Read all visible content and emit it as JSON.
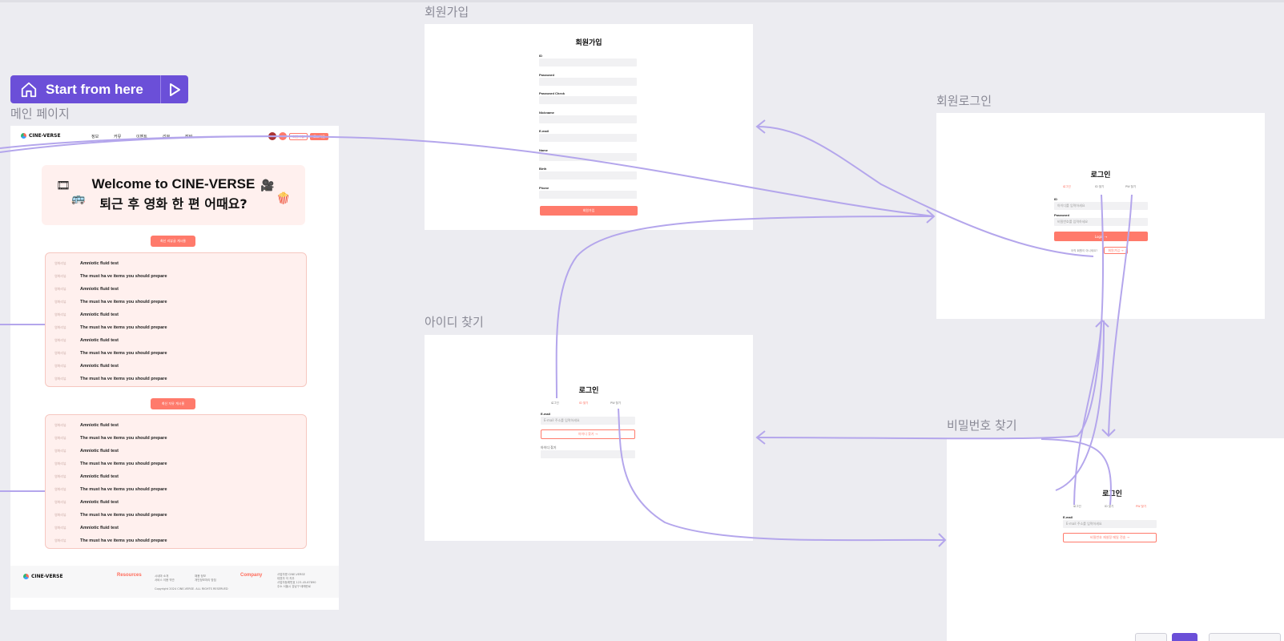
{
  "start": {
    "label": "Start from here"
  },
  "frames": {
    "main": "메인 페이지",
    "signup": "회원가입",
    "login": "회원로그인",
    "findid": "아이디 찾기",
    "findpw": "비밀번호 찾기"
  },
  "main_page": {
    "logo": "CINE-VERSE",
    "menu": [
      "정보",
      "커뮤",
      "이벤트",
      "리뷰",
      "장바"
    ],
    "join_label": "회원가입",
    "logout_label": "로그아웃",
    "hero_title": "Welcome to CINE-VERSE",
    "hero_subtitle": "퇴근 후 영화 한 편 어때요?",
    "section1_button": "최신 리뷰글 게시물",
    "section2_button": "최신 자유 게시물",
    "board_tag": "영화리뷰",
    "board1": [
      "Amniotic fluid test",
      "The must ha ve items you should prepare",
      "Amniotic fluid test",
      "The must ha ve items you should prepare",
      "Amniotic fluid test",
      "The must ha ve items you should prepare",
      "Amniotic fluid test",
      "The must ha ve items you should prepare",
      "Amniotic fluid test",
      "The must ha ve items you should prepare"
    ],
    "board2": [
      "Amniotic fluid test",
      "The must ha ve items you should prepare",
      "Amniotic fluid test",
      "The must ha ve items you should prepare",
      "Amniotic fluid test",
      "The must ha ve items you should prepare",
      "Amniotic fluid test",
      "The must ha ve items you should prepare",
      "Amniotic fluid test",
      "The must ha ve items you should prepare"
    ],
    "footer_logo": "CINE-VERSE",
    "footer_resources": "Resources",
    "footer_company": "Company",
    "footer_col1": "시네마 소개\n서비스 이용 약관",
    "footer_col2": "채용 정보\n개인정보처리 방침",
    "footer_col3": "사업자명 CINE-VERSE\n대표자 이 지우\n사업자등록번호 123-45-67890\n주소 서울시 강남구 테헤란로",
    "footer_copyright": "Copyright 2024 CINE-VERSE. ALL RIGHTS RESERVED"
  },
  "signup": {
    "title": "회원가입",
    "fields": [
      "ID",
      "Password",
      "Password Check",
      "Nickname",
      "E-mail",
      "Name",
      "Birth",
      "Phone"
    ],
    "submit": "회원가입"
  },
  "login": {
    "title": "로그인",
    "tabs": [
      "로그인",
      "ID 찾기",
      "PW 찾기"
    ],
    "id_label": "ID",
    "id_placeholder": "아이디를 입력하세요",
    "pw_label": "Password",
    "pw_placeholder": "비밀번호를 입력하세요",
    "submit": "Login →",
    "signup_prompt": "아직 회원이 아니세요?",
    "signup_link": "회원가입 →"
  },
  "findid": {
    "title": "로그인",
    "tabs": [
      "로그인",
      "ID 찾기",
      "PW 찾기"
    ],
    "email_label": "E-mail",
    "email_placeholder": "E-mail 주소를 입력하세요",
    "submit": "아이디 찾기 →",
    "result_label": "아이디 찾기"
  },
  "findpw": {
    "title": "로그인",
    "tabs": [
      "로그인",
      "ID 찾기",
      "PW 찾기"
    ],
    "email_label": "E-mail",
    "email_placeholder": "E-mail 주소를 입력하세요",
    "submit": "비밀번호 재설정 메일 전송 →"
  },
  "colors": {
    "accent": "#ff7a6b",
    "flow": "#b4a6ec",
    "start": "#6b4fd8"
  }
}
